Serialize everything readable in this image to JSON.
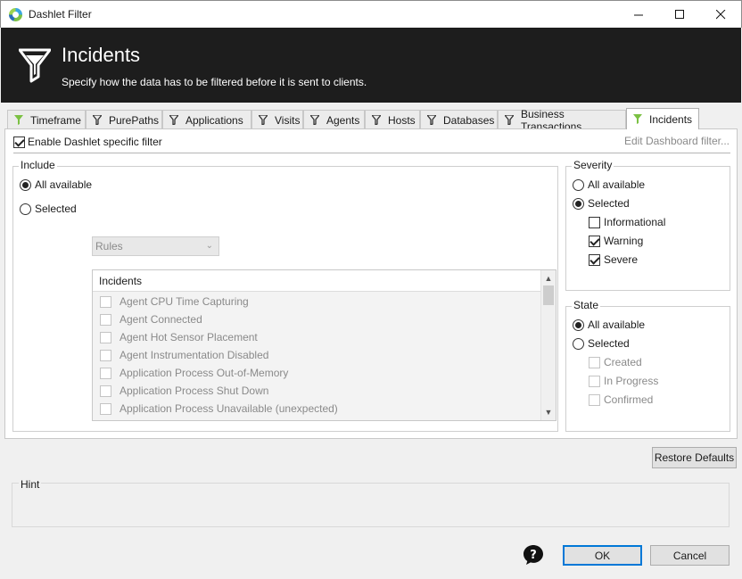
{
  "window": {
    "title": "Dashlet Filter"
  },
  "banner": {
    "title": "Incidents",
    "subtitle": "Specify how the data has to be filtered before it is sent to clients."
  },
  "tabs": [
    {
      "label": "Timeframe",
      "active": false
    },
    {
      "label": "PurePaths",
      "active": false
    },
    {
      "label": "Applications",
      "active": false
    },
    {
      "label": "Visits",
      "active": false
    },
    {
      "label": "Agents",
      "active": false
    },
    {
      "label": "Hosts",
      "active": false
    },
    {
      "label": "Databases",
      "active": false
    },
    {
      "label": "Business Transactions",
      "active": false
    },
    {
      "label": "Incidents",
      "active": true
    }
  ],
  "filter": {
    "enable_label": "Enable Dashlet specific filter",
    "enable_checked": true,
    "edit_link": "Edit Dashboard filter..."
  },
  "include": {
    "group_label": "Include",
    "all_available_label": "All available",
    "selected_label": "Selected",
    "rules_value": "Rules",
    "list_header": "Incidents",
    "items": [
      "Agent CPU Time Capturing",
      "Agent Connected",
      "Agent Hot Sensor Placement",
      "Agent Instrumentation Disabled",
      "Application Process Out-of-Memory",
      "Application Process Shut Down",
      "Application Process Unavailable (unexpected)"
    ]
  },
  "severity": {
    "group_label": "Severity",
    "all_available_label": "All available",
    "selected_label": "Selected",
    "options": [
      {
        "label": "Informational",
        "checked": false
      },
      {
        "label": "Warning",
        "checked": true
      },
      {
        "label": "Severe",
        "checked": true
      }
    ]
  },
  "state": {
    "group_label": "State",
    "all_available_label": "All available",
    "selected_label": "Selected",
    "options": [
      {
        "label": "Created",
        "checked": false
      },
      {
        "label": "In Progress",
        "checked": false
      },
      {
        "label": "Confirmed",
        "checked": false
      }
    ]
  },
  "footer": {
    "restore_label": "Restore Defaults",
    "hint_label": "Hint",
    "ok_label": "OK",
    "cancel_label": "Cancel"
  },
  "colors": {
    "banner_bg": "#1d1d1d",
    "filter_icon_active": "#7bc143",
    "focus_border": "#0078d7"
  }
}
